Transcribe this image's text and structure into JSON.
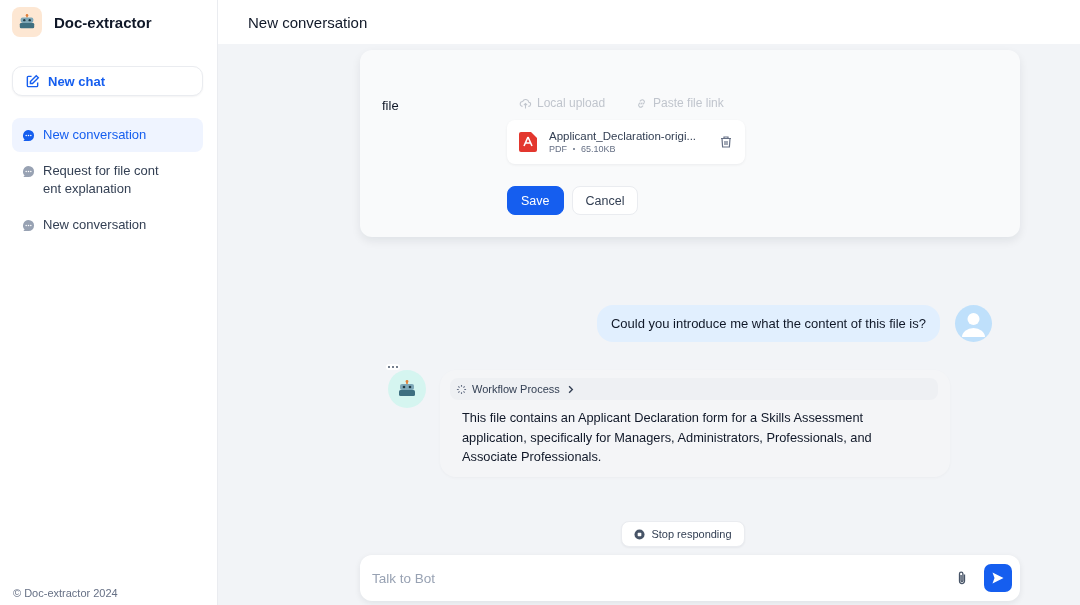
{
  "app": {
    "name": "Doc-extractor"
  },
  "new_chat": "New chat",
  "conversations": [
    {
      "title": "New conversation",
      "selected": true
    },
    {
      "title": "Request for file cont ent explanation",
      "selected": false
    },
    {
      "title": "New conversation",
      "selected": false
    }
  ],
  "footer": "© Doc-extractor 2024",
  "header": {
    "title": "New conversation"
  },
  "form": {
    "label": "file",
    "upload_options": [
      {
        "label": "Local upload",
        "kind": "upload",
        "disabled": true
      },
      {
        "label": "Paste file link",
        "kind": "link",
        "disabled": true
      }
    ],
    "file": {
      "name": "Applicant_Declaration-origi...",
      "type": "PDF",
      "size": "65.10KB"
    },
    "buttons": [
      {
        "label": "Save",
        "kind": "primary"
      },
      {
        "label": "Cancel",
        "kind": "secondary"
      }
    ]
  },
  "messages": [
    {
      "kind": "user",
      "text": "Could you introduce me what the content of this file is?"
    },
    {
      "kind": "bot",
      "workflow": "Workflow Process",
      "text": "This file contains an Applicant Declaration form for a Skills Assessment application, specifically for Managers, Administrators, Professionals, and Associate Professionals."
    }
  ],
  "stop_button": "Stop responding",
  "input": {
    "placeholder": "Talk to Bot"
  }
}
